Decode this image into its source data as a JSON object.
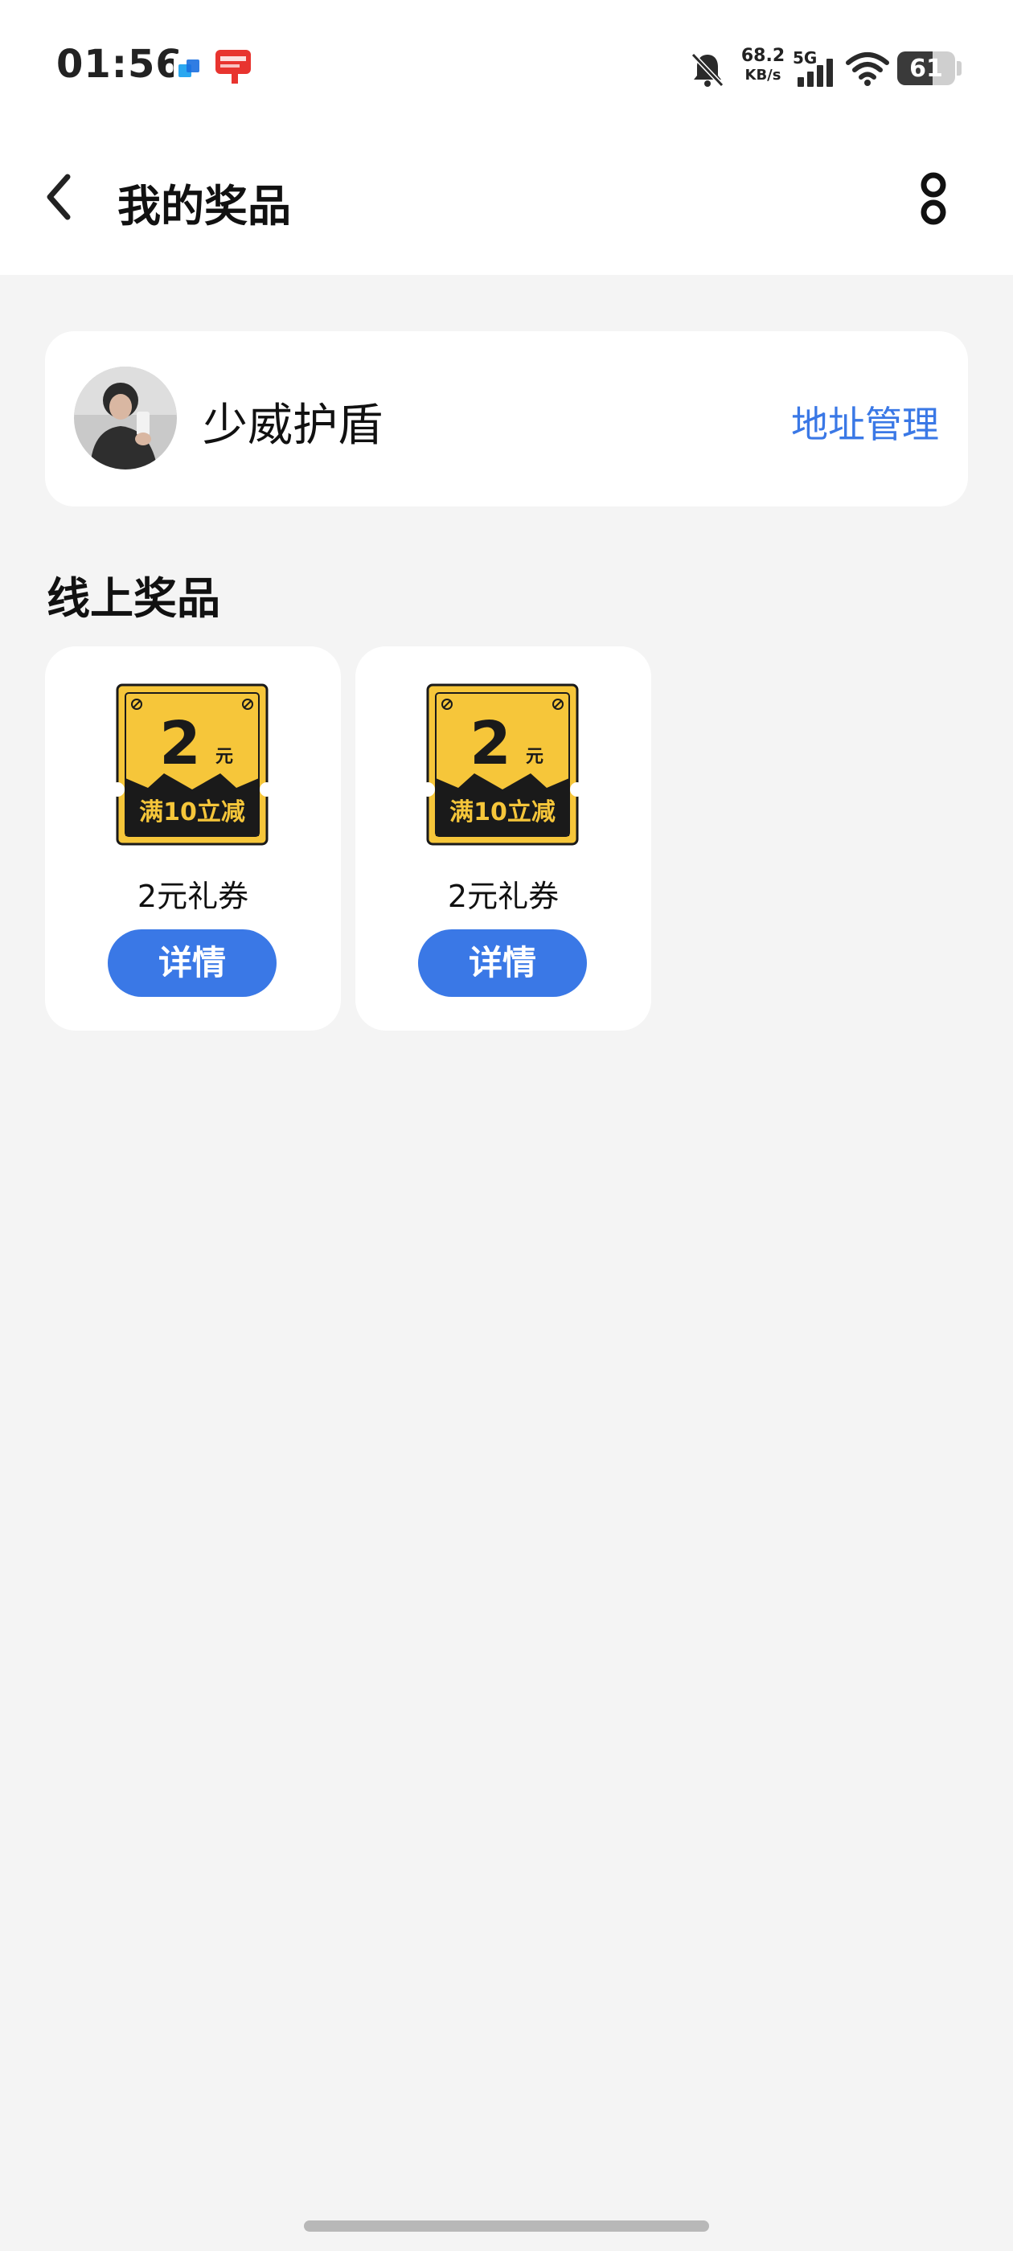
{
  "status_bar": {
    "time": "01:56",
    "net_speed_value": "68.2",
    "net_speed_unit": "KB/s",
    "network_type": "5G",
    "battery_level": "61",
    "icons": [
      "blue-app-icon",
      "red-app-icon",
      "mute-bell-icon",
      "signal-icon",
      "wifi-icon",
      "battery-icon"
    ]
  },
  "header": {
    "title": "我的奖品",
    "icons": [
      "back-icon",
      "more-icon"
    ]
  },
  "user": {
    "name": "少威护盾",
    "address_link": "地址管理"
  },
  "section": {
    "title": "线上奖品"
  },
  "prizes": [
    {
      "name": "2元礼券",
      "button": "详情",
      "coupon": {
        "amount": "2",
        "unit": "元",
        "condition": "满10立减"
      }
    },
    {
      "name": "2元礼券",
      "button": "详情",
      "coupon": {
        "amount": "2",
        "unit": "元",
        "condition": "满10立减"
      }
    }
  ],
  "colors": {
    "accent": "#3a78e6",
    "background": "#f4f4f4",
    "card": "#ffffff",
    "coupon_yellow": "#f6c63a",
    "coupon_dark": "#1a1a1a"
  }
}
